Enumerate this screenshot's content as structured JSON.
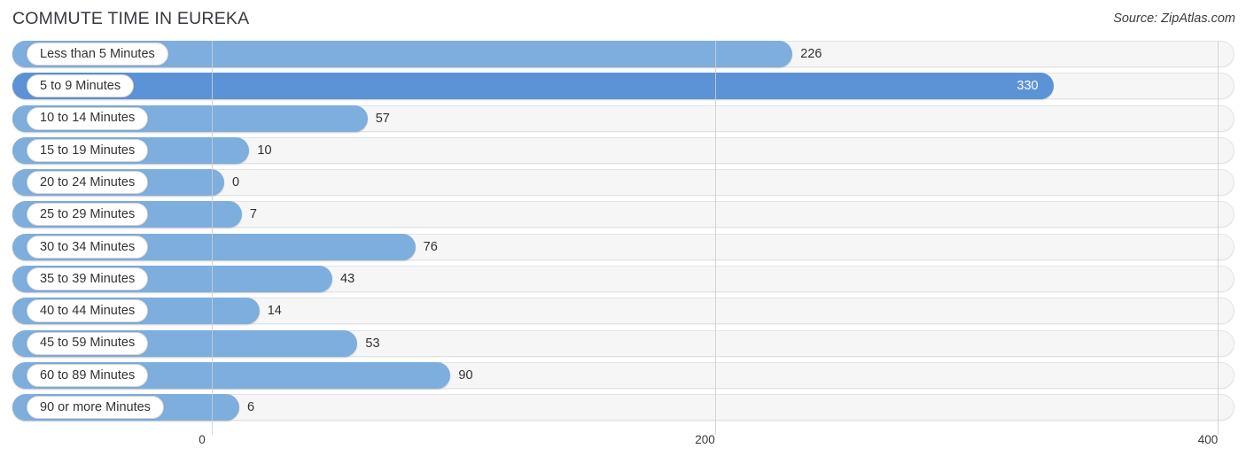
{
  "header": {
    "title": "COMMUTE TIME IN EUREKA",
    "source": "Source: ZipAtlas.com"
  },
  "colors": {
    "bar": "#7eaedd",
    "bar_strong": "#5b93d6",
    "track": "#f6f6f6",
    "gridline": "#cfcfcf",
    "text": "#333333"
  },
  "chart_data": {
    "type": "bar",
    "orientation": "horizontal",
    "title": "COMMUTE TIME IN EUREKA",
    "subtitle": "",
    "xlabel": "",
    "ylabel": "",
    "source": "Source: ZipAtlas.com",
    "xlim": [
      0,
      400
    ],
    "xticks": [
      0,
      200,
      400
    ],
    "xtick_labels": [
      "0",
      "200",
      "400"
    ],
    "grid": true,
    "legend": false,
    "categories": [
      "Less than 5 Minutes",
      "5 to 9 Minutes",
      "10 to 14 Minutes",
      "15 to 19 Minutes",
      "20 to 24 Minutes",
      "25 to 29 Minutes",
      "30 to 34 Minutes",
      "35 to 39 Minutes",
      "40 to 44 Minutes",
      "45 to 59 Minutes",
      "60 to 89 Minutes",
      "90 or more Minutes"
    ],
    "values": [
      226,
      330,
      57,
      10,
      0,
      7,
      76,
      43,
      14,
      53,
      90,
      6
    ],
    "value_labels": [
      "226",
      "330",
      "57",
      "10",
      "0",
      "7",
      "76",
      "43",
      "14",
      "53",
      "90",
      "6"
    ]
  },
  "rows": [
    {
      "label": "Less than 5 Minutes",
      "value": 226,
      "value_label": "226",
      "label_inside": false,
      "strong": false
    },
    {
      "label": "5 to 9 Minutes",
      "value": 330,
      "value_label": "330",
      "label_inside": true,
      "strong": true
    },
    {
      "label": "10 to 14 Minutes",
      "value": 57,
      "value_label": "57",
      "label_inside": false,
      "strong": false
    },
    {
      "label": "15 to 19 Minutes",
      "value": 10,
      "value_label": "10",
      "label_inside": false,
      "strong": false
    },
    {
      "label": "20 to 24 Minutes",
      "value": 0,
      "value_label": "0",
      "label_inside": false,
      "strong": false
    },
    {
      "label": "25 to 29 Minutes",
      "value": 7,
      "value_label": "7",
      "label_inside": false,
      "strong": false
    },
    {
      "label": "30 to 34 Minutes",
      "value": 76,
      "value_label": "76",
      "label_inside": false,
      "strong": false
    },
    {
      "label": "35 to 39 Minutes",
      "value": 43,
      "value_label": "43",
      "label_inside": false,
      "strong": false
    },
    {
      "label": "40 to 44 Minutes",
      "value": 14,
      "value_label": "14",
      "label_inside": false,
      "strong": false
    },
    {
      "label": "45 to 59 Minutes",
      "value": 53,
      "value_label": "53",
      "label_inside": false,
      "strong": false
    },
    {
      "label": "60 to 89 Minutes",
      "value": 90,
      "value_label": "90",
      "label_inside": false,
      "strong": false
    },
    {
      "label": "90 or more Minutes",
      "value": 6,
      "value_label": "6",
      "label_inside": false,
      "strong": false
    }
  ],
  "axis": {
    "ticks": [
      {
        "label": "0",
        "value": 0
      },
      {
        "label": "200",
        "value": 200
      },
      {
        "label": "400",
        "value": 400
      }
    ]
  }
}
